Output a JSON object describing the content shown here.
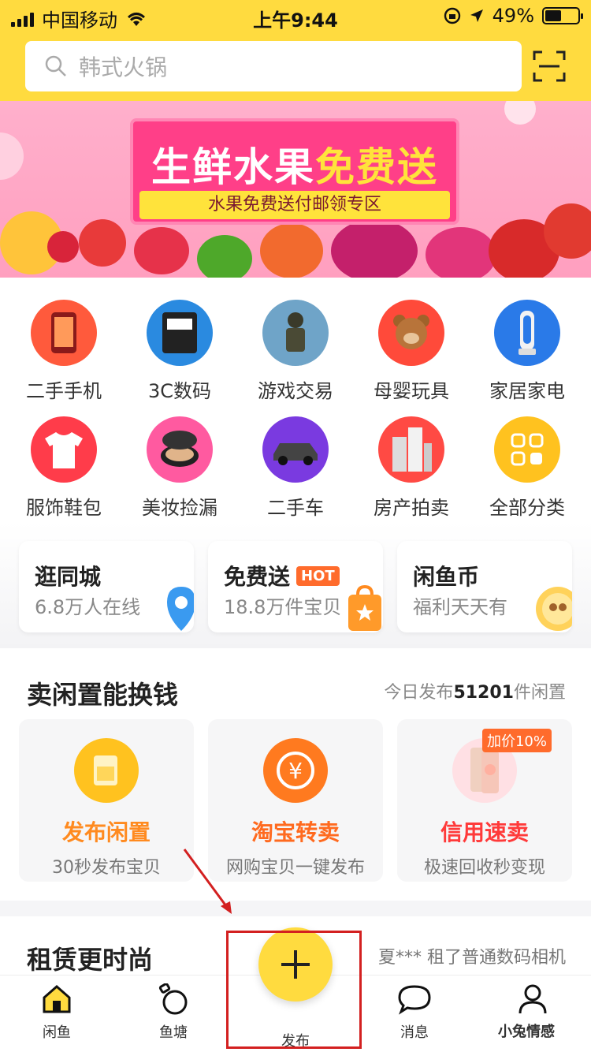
{
  "status_bar": {
    "carrier": "中国移动",
    "time": "上午9:44",
    "battery": "49%",
    "battery_level": 0.49
  },
  "search": {
    "placeholder": "韩式火锅"
  },
  "banner": {
    "title_a": "生鲜水果",
    "title_b": "免费送",
    "subtitle": "水果免费送付邮领专区"
  },
  "categories": [
    {
      "label": "二手手机",
      "icon": "phone-icon"
    },
    {
      "label": "3C数码",
      "icon": "memory-card-icon"
    },
    {
      "label": "游戏交易",
      "icon": "game-character-icon"
    },
    {
      "label": "母婴玩具",
      "icon": "bear-toy-icon"
    },
    {
      "label": "家居家电",
      "icon": "fan-icon"
    },
    {
      "label": "服饰鞋包",
      "icon": "shirt-icon"
    },
    {
      "label": "美妆捡漏",
      "icon": "cushion-compact-icon"
    },
    {
      "label": "二手车",
      "icon": "car-icon"
    },
    {
      "label": "房产拍卖",
      "icon": "building-icon"
    },
    {
      "label": "全部分类",
      "icon": "grid-icon"
    }
  ],
  "promos": [
    {
      "title": "逛同城",
      "subtitle": "6.8万人在线"
    },
    {
      "title": "免费送",
      "badge": "HOT",
      "subtitle": "18.8万件宝贝"
    },
    {
      "title": "闲鱼币",
      "subtitle": "福利天天有"
    }
  ],
  "sell": {
    "title": "卖闲置能换钱",
    "stat_prefix": "今日发布",
    "stat_count": "51201",
    "stat_suffix": "件闲置",
    "cards": [
      {
        "name": "发布闲置",
        "desc": "30秒发布宝贝"
      },
      {
        "name": "淘宝转卖",
        "desc": "网购宝贝一键发布"
      },
      {
        "name": "信用速卖",
        "desc": "极速回收秒变现",
        "badge": "加价10%"
      }
    ]
  },
  "rent": {
    "title": "租赁更时尚",
    "ticker": "夏*** 租了普通数码相机"
  },
  "tabs": [
    {
      "label": "闲鱼"
    },
    {
      "label": "鱼塘"
    },
    {
      "label": "发布"
    },
    {
      "label": "消息"
    },
    {
      "label": "我的"
    }
  ],
  "colors": {
    "brand": "#ffdb3f",
    "accent_orange": "#ff8a1f",
    "accent_red": "#ff4d3a"
  },
  "watermark": {
    "text": "小兔情感"
  }
}
